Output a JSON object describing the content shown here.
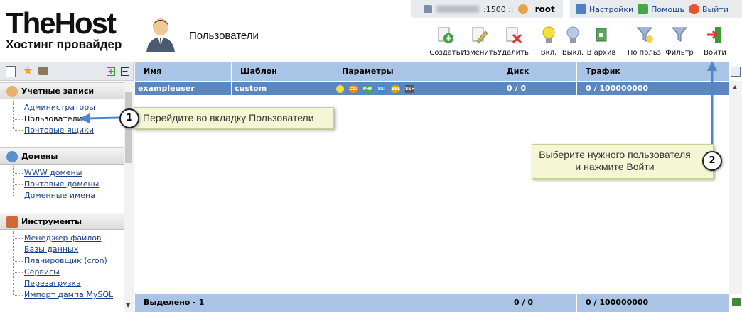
{
  "header": {
    "server": ":1500 ::",
    "user": "root",
    "links": [
      {
        "label": "Настройки",
        "icon": "settings-icon"
      },
      {
        "label": "Помощь",
        "icon": "help-icon"
      },
      {
        "label": "Выйти",
        "icon": "power-icon"
      }
    ]
  },
  "logo": {
    "main": "TheHost",
    "sub": "Хостинг провайдер"
  },
  "page_title": "Пользователи",
  "toolbar": [
    {
      "label": "Создать",
      "icon": "create-icon"
    },
    {
      "label": "Изменить",
      "icon": "edit-icon"
    },
    {
      "label": "Удалить",
      "icon": "delete-icon"
    },
    {
      "label": "Вкл.",
      "icon": "bulb-on-icon"
    },
    {
      "label": "Выкл.",
      "icon": "bulb-off-icon"
    },
    {
      "label": "В архив",
      "icon": "archive-icon"
    },
    {
      "label": "По польз.",
      "icon": "filter-user-icon"
    },
    {
      "label": "Фильтр",
      "icon": "filter-icon"
    },
    {
      "label": "Войти",
      "icon": "login-icon"
    }
  ],
  "sidebar": {
    "sections": [
      {
        "title": "Учетные записи",
        "items": [
          "Администраторы",
          "Пользователи",
          "Почтовые ящики"
        ]
      },
      {
        "title": "Домены",
        "items": [
          "WWW домены",
          "Почтовые домены",
          "Доменные имена"
        ]
      },
      {
        "title": "Инструменты",
        "items": [
          "Менеджер файлов",
          "Базы данных",
          "Планировщик (cron)",
          "Сервисы",
          "Перезагрузка",
          "Импорт дампа MySQL"
        ]
      }
    ]
  },
  "table": {
    "columns": [
      "Имя",
      "Шаблон",
      "Параметры",
      "Диск",
      "Трафик"
    ],
    "rows": [
      {
        "name": "exampleuser",
        "template": "custom",
        "disk": "0 / 0",
        "traffic": "0 / 100000000"
      }
    ],
    "params": [
      "CGI",
      "PHP",
      "SSI",
      "SSL",
      "SSH"
    ],
    "footer": {
      "selected": "Выделено - 1",
      "disk": "0 / 0",
      "traffic": "0 / 100000000"
    }
  },
  "callouts": [
    {
      "num": "1",
      "text": "Перейдите во вкладку Пользователи"
    },
    {
      "num": "2",
      "line1": "Выберите нужного пользователя",
      "line2": "и нажмите Войти"
    }
  ],
  "colors": {
    "header_blue": "#a9c4e4",
    "selected_row": "#5c86c0",
    "callout_bg": "#f4f6d4"
  }
}
